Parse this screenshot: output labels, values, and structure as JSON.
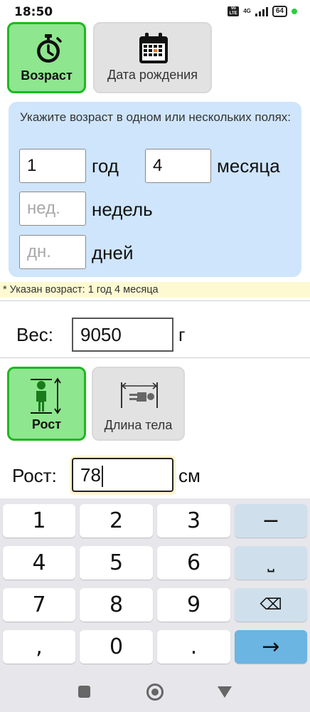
{
  "status_bar": {
    "time": "18:50",
    "volte": "Vo LTE",
    "network": "4G",
    "battery": "64"
  },
  "age_mode": {
    "age_button_label": "Возраст",
    "age_icon": "stopwatch-icon",
    "birthdate_button_label": "Дата рождения",
    "birthdate_icon": "calendar-icon"
  },
  "age_form": {
    "hint": "Укажите возраст в одном или нескольких полях:",
    "years_value": "1",
    "years_unit": "год",
    "months_value": "4",
    "months_unit": "месяца",
    "weeks_placeholder": "нед.",
    "weeks_unit": "недель",
    "days_placeholder": "дн.",
    "days_unit": "дней"
  },
  "age_note": "* Указан возраст: 1 год 4 месяца",
  "weight": {
    "label": "Вес:",
    "value": "9050",
    "unit": "г"
  },
  "height_mode": {
    "height_button_label": "Рост",
    "height_icon": "standing-person-icon",
    "length_button_label": "Длина тела",
    "length_icon": "lying-person-icon"
  },
  "height": {
    "label": "Рост:",
    "value": "78",
    "unit": "см"
  },
  "keyboard": {
    "rows": [
      [
        "1",
        "2",
        "3",
        "−"
      ],
      [
        "4",
        "5",
        "6",
        "⎵"
      ],
      [
        "7",
        "8",
        "9",
        "⌫"
      ],
      [
        ",",
        "0",
        ".",
        "→"
      ]
    ]
  },
  "colors": {
    "active_green": "#8ee68e",
    "active_border": "#1fb81f",
    "panel_blue": "#cfe5fb",
    "note_yellow": "#fdfad2",
    "enter_blue": "#6bb5e3"
  }
}
